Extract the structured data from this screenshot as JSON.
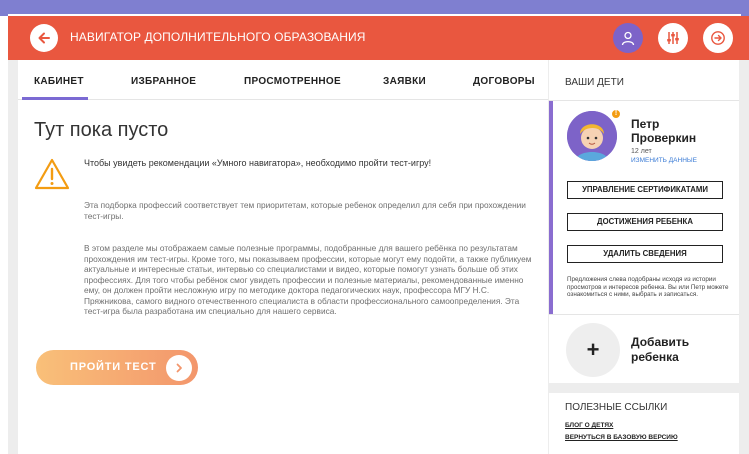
{
  "header": {
    "title": "НАВИГАТОР ДОПОЛНИТЕЛЬНОГО ОБРАЗОВАНИЯ",
    "color": "#e9573f"
  },
  "tabs": [
    {
      "label": "КАБИНЕТ",
      "active": true
    },
    {
      "label": "ИЗБРАННОЕ",
      "active": false
    },
    {
      "label": "ПРОСМОТРЕННОЕ",
      "active": false
    },
    {
      "label": "ЗАЯВКИ",
      "active": false
    },
    {
      "label": "ДОГОВОРЫ",
      "active": false
    }
  ],
  "main": {
    "title": "Тут пока пусто",
    "notice": "Чтобы увидеть рекомендации «Умного навигатора», необходимо пройти тест-игру!",
    "paragraph1": "Эта подборка профессий соответствует тем приоритетам, которые ребенок определил для себя при прохождении тест-игры.",
    "paragraph2": "В этом разделе мы отображаем самые полезные программы, подобранные для вашего ребёнка по результатам прохождения им тест-игры. Кроме того, мы показываем профессии, которые могут ему подойти, а также публикуем актуальные и интересные статьи, интервью со специалистами и видео, которые помогут узнать больше об этих профессиях. Для того чтобы ребёнок смог увидеть профессии и полезные материалы, рекомендованные именно ему, он должен пройти несложную игру по методике доктора педагогических наук, профессора МГУ Н.С. Пряжникова, самого видного отечественного специалиста в области профессионального самоопределения. Эта тест-игра была разработана им специально для нашего сервиса.",
    "test_button": "ПРОЙТИ ТЕСТ"
  },
  "sidebar": {
    "header": "ВАШИ ДЕТИ",
    "child": {
      "first_name": "Петр",
      "last_name": "Проверкин",
      "age": "12 лет",
      "edit_link": "ИЗМЕНИТЬ ДАННЫЕ",
      "badge": "!",
      "buttons": [
        "УПРАВЛЕНИЕ СЕРТИФИКАТАМИ",
        "ДОСТИЖЕНИЯ РЕБЕНКА",
        "УДАЛИТЬ СВЕДЕНИЯ"
      ],
      "note": "Предложения слева подобраны исходя из истории просмотров и интересов ребенка. Вы или Петр можете ознакомиться с ними, выбрать и записаться."
    },
    "add_child": {
      "icon": "+",
      "label_line1": "Добавить",
      "label_line2": "ребенка"
    },
    "links_title": "ПОЛЕЗНЫЕ ССЫЛКИ",
    "links": [
      "БЛОГ О ДЕТЯХ",
      "ВЕРНУТЬСЯ В БАЗОВУЮ ВЕРСИЮ"
    ]
  },
  "icons": {
    "back": "arrow-left-icon",
    "user": "user-icon",
    "filter": "sliders-icon",
    "logout": "logout-icon",
    "warning": "warning-icon",
    "arrow": "chevron-right-icon"
  },
  "colors": {
    "accent": "#7b6ad3",
    "warning": "#f39c12",
    "button_gradient_start": "#f9c079",
    "button_gradient_end": "#f3966c"
  }
}
